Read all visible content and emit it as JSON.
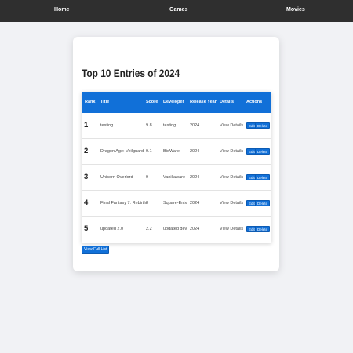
{
  "nav": {
    "home": "Home",
    "games": "Games",
    "movies": "Movies"
  },
  "page": {
    "title": "Top 10 Entries of 2024",
    "view_full_list": "View Full List"
  },
  "table": {
    "headers": {
      "rank": "Rank",
      "title": "Title",
      "score": "Score",
      "developer": "Developer",
      "release_year": "Release Year",
      "details": "Details",
      "actions": "Actions"
    },
    "rows": [
      {
        "rank": "1",
        "title": "testing",
        "score": "9.8",
        "developer": "testing",
        "year": "2024",
        "details": "View Details",
        "edit": "Edit",
        "delete": "Delete"
      },
      {
        "rank": "2",
        "title": "Dragon Age: Veilguard",
        "score": "9.1",
        "developer": "BioWare",
        "year": "2024",
        "details": "View Details",
        "edit": "Edit",
        "delete": "Delete"
      },
      {
        "rank": "3",
        "title": "Unicorn Overlord",
        "score": "9",
        "developer": "Vanillaware",
        "year": "2024",
        "details": "View Details",
        "edit": "Edit",
        "delete": "Delete"
      },
      {
        "rank": "4",
        "title": "Final Fantasy 7: Rebirth",
        "score": "8",
        "developer": "Square-Enix",
        "year": "2024",
        "details": "View Details",
        "edit": "Edit",
        "delete": "Delete"
      },
      {
        "rank": "5",
        "title": "updated 2.0",
        "score": "2.2",
        "developer": "updated dev",
        "year": "2024",
        "details": "View Details",
        "edit": "Edit",
        "delete": "Delete"
      }
    ]
  },
  "colors": {
    "navbar": "#2f2f2f",
    "accent": "#1170d8",
    "background": "#f1f2f5"
  }
}
